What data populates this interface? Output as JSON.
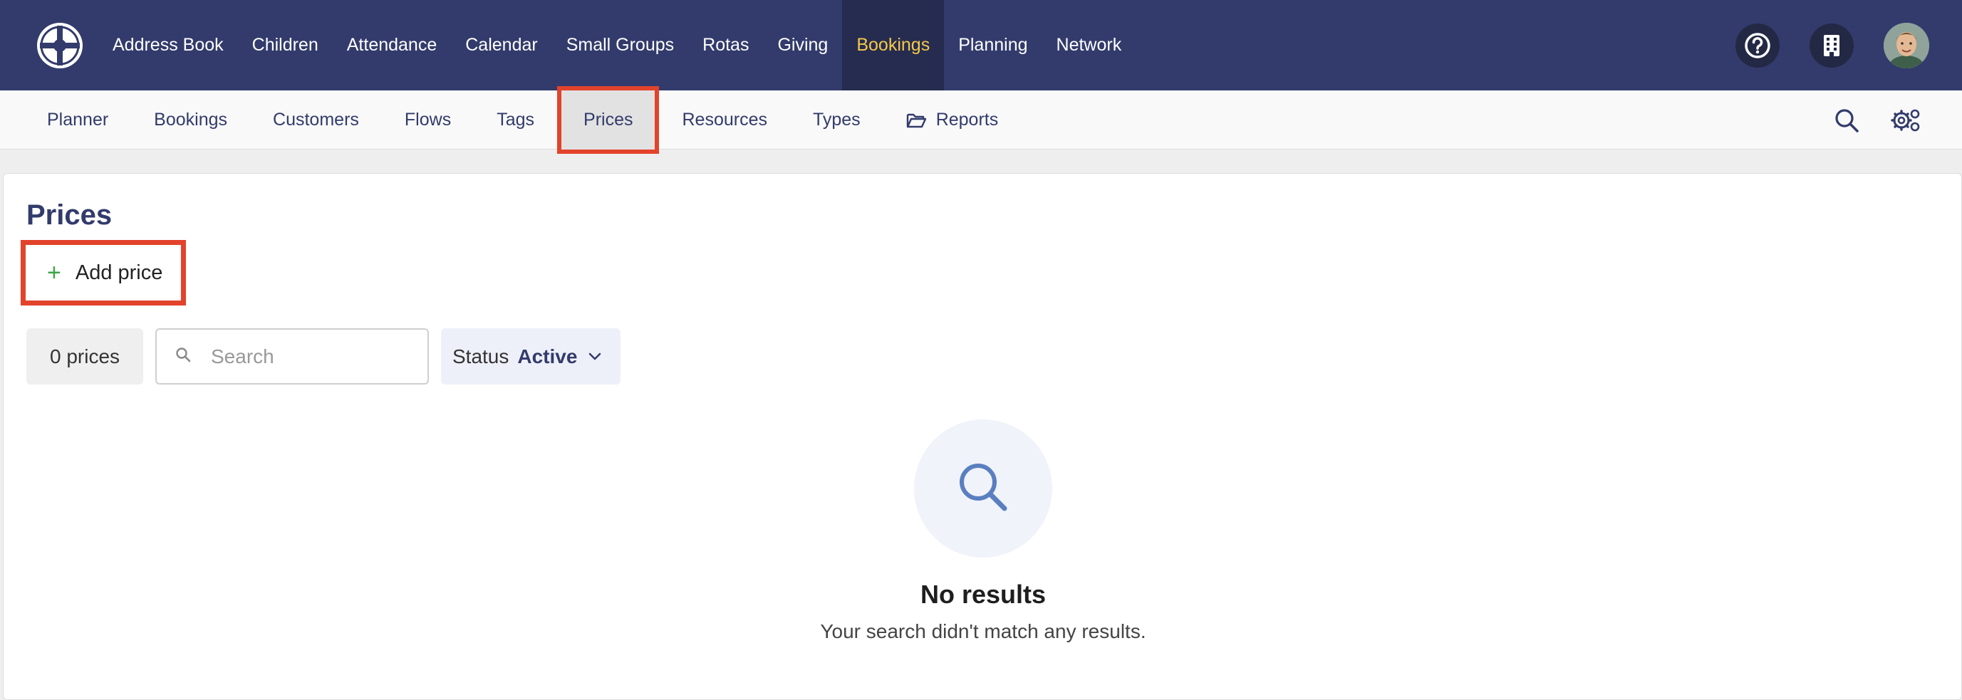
{
  "colors": {
    "nav_bg": "#323b6b",
    "nav_active_bg": "#262c4f",
    "nav_active_text": "#f4c84a",
    "highlight_box": "#e2432b",
    "add_icon": "#3aa647",
    "empty_icon": "#5a7fc0"
  },
  "topnav": {
    "logo_icon": "wheel-logo-icon",
    "items": [
      {
        "label": "Address Book"
      },
      {
        "label": "Children"
      },
      {
        "label": "Attendance"
      },
      {
        "label": "Calendar"
      },
      {
        "label": "Small Groups"
      },
      {
        "label": "Rotas"
      },
      {
        "label": "Giving"
      },
      {
        "label": "Bookings",
        "active": true
      },
      {
        "label": "Planning"
      },
      {
        "label": "Network"
      }
    ],
    "right_icons": [
      "help-icon",
      "building-icon",
      "avatar"
    ]
  },
  "subnav": {
    "items": [
      {
        "label": "Planner"
      },
      {
        "label": "Bookings"
      },
      {
        "label": "Customers"
      },
      {
        "label": "Flows"
      },
      {
        "label": "Tags"
      },
      {
        "label": "Prices",
        "active": true
      },
      {
        "label": "Resources"
      },
      {
        "label": "Types"
      },
      {
        "label": "Reports",
        "icon": "folder-open-icon"
      }
    ],
    "right_icons": [
      "search-icon",
      "settings-gears-icon"
    ]
  },
  "main": {
    "title": "Prices",
    "add_button": "Add price",
    "count": "0 prices",
    "search_placeholder": "Search",
    "status_label": "Status",
    "status_value": "Active",
    "empty_title": "No results",
    "empty_subtitle": "Your search didn't match any results."
  }
}
